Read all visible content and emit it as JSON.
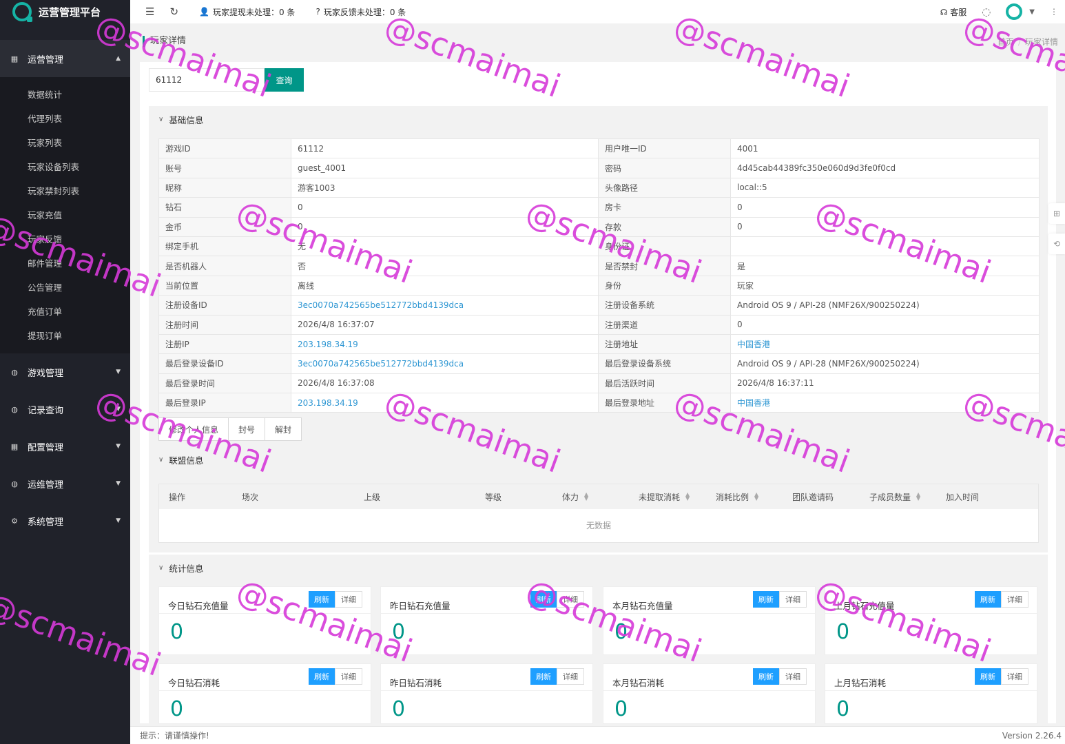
{
  "app": {
    "title": "运营管理平台"
  },
  "header": {
    "withdraw_tip": "玩家提现未处理：0 条",
    "feedback_tip": "玩家反馈未处理：0 条",
    "service": "客服"
  },
  "sidebar": {
    "groups": [
      {
        "label": "运营管理",
        "icon": "grid-icon",
        "open": true,
        "items": [
          "数据统计",
          "代理列表",
          "玩家列表",
          "玩家设备列表",
          "玩家禁封列表",
          "玩家充值",
          "玩家反馈",
          "邮件管理",
          "公告管理",
          "充值订单",
          "提现订单"
        ]
      },
      {
        "label": "游戏管理",
        "icon": "gamepad-icon"
      },
      {
        "label": "记录查询",
        "icon": "gamepad-icon"
      },
      {
        "label": "配置管理",
        "icon": "grid-icon"
      },
      {
        "label": "运维管理",
        "icon": "gamepad-icon"
      },
      {
        "label": "系统管理",
        "icon": "gear-icon"
      }
    ]
  },
  "breadcrumb": {
    "page_title": "玩家详情",
    "home": "首页",
    "current": "玩家详情"
  },
  "search": {
    "value": "61112",
    "button": "查询"
  },
  "basic": {
    "title": "基础信息",
    "rows": [
      [
        "游戏ID",
        "61112",
        "用户唯一ID",
        "4001"
      ],
      [
        "账号",
        "guest_4001",
        "密码",
        "4d45cab44389fc350e060d9d3fe0f0cd"
      ],
      [
        "昵称",
        "游客1003",
        "头像路径",
        "local::5"
      ],
      [
        "钻石",
        "0",
        "房卡",
        "0"
      ],
      [
        "金币",
        "0",
        "存款",
        "0"
      ],
      [
        "绑定手机",
        "无",
        "身份证",
        ""
      ],
      [
        "是否机器人",
        "否",
        "是否禁封",
        "是"
      ],
      [
        "当前位置",
        "离线",
        "身份",
        "玩家"
      ],
      [
        "注册设备ID",
        "3ec0070a742565be512772bbd4139dca",
        "注册设备系统",
        "Android OS 9 / API-28 (NMF26X/900250224)"
      ],
      [
        "注册时间",
        "2026/4/8 16:37:07",
        "注册渠道",
        "0"
      ],
      [
        "注册IP",
        "203.198.34.19",
        "注册地址",
        "中国香港"
      ],
      [
        "最后登录设备ID",
        "3ec0070a742565be512772bbd4139dca",
        "最后登录设备系统",
        "Android OS 9 / API-28 (NMF26X/900250224)"
      ],
      [
        "最后登录时间",
        "2026/4/8 16:37:08",
        "最后活跃时间",
        "2026/4/8 16:37:11"
      ],
      [
        "最后登录IP",
        "203.198.34.19",
        "最后登录地址",
        "中国香港"
      ]
    ],
    "buttons": [
      "修改个人信息",
      "封号",
      "解封"
    ]
  },
  "alliance": {
    "title": "联盟信息",
    "columns": [
      "操作",
      "场次",
      "上级",
      "等级",
      "体力",
      "未提取消耗",
      "消耗比例",
      "团队邀请码",
      "子成员数量",
      "加入时间"
    ],
    "empty": "无数据"
  },
  "stats": {
    "title": "统计信息",
    "refresh": "刷新",
    "detail": "详细",
    "cards": [
      {
        "label": "今日钻石充值量",
        "value": "0"
      },
      {
        "label": "昨日钻石充值量",
        "value": "0"
      },
      {
        "label": "本月钻石充值量",
        "value": "0"
      },
      {
        "label": "上月钻石充值量",
        "value": "0"
      },
      {
        "label": "今日钻石消耗",
        "value": "0"
      },
      {
        "label": "昨日钻石消耗",
        "value": "0"
      },
      {
        "label": "本月钻石消耗",
        "value": "0"
      },
      {
        "label": "上月钻石消耗",
        "value": "0"
      }
    ]
  },
  "footer": {
    "tip": "提示：请谨慎操作!",
    "version": "Version 2.26.4"
  },
  "watermark": "@scmaimai",
  "colors": {
    "accent": "#009688",
    "link": "#2f97d3",
    "refresh": "#1e9fff",
    "sidebar": "#20222a",
    "watermark": "#d63ad9"
  }
}
